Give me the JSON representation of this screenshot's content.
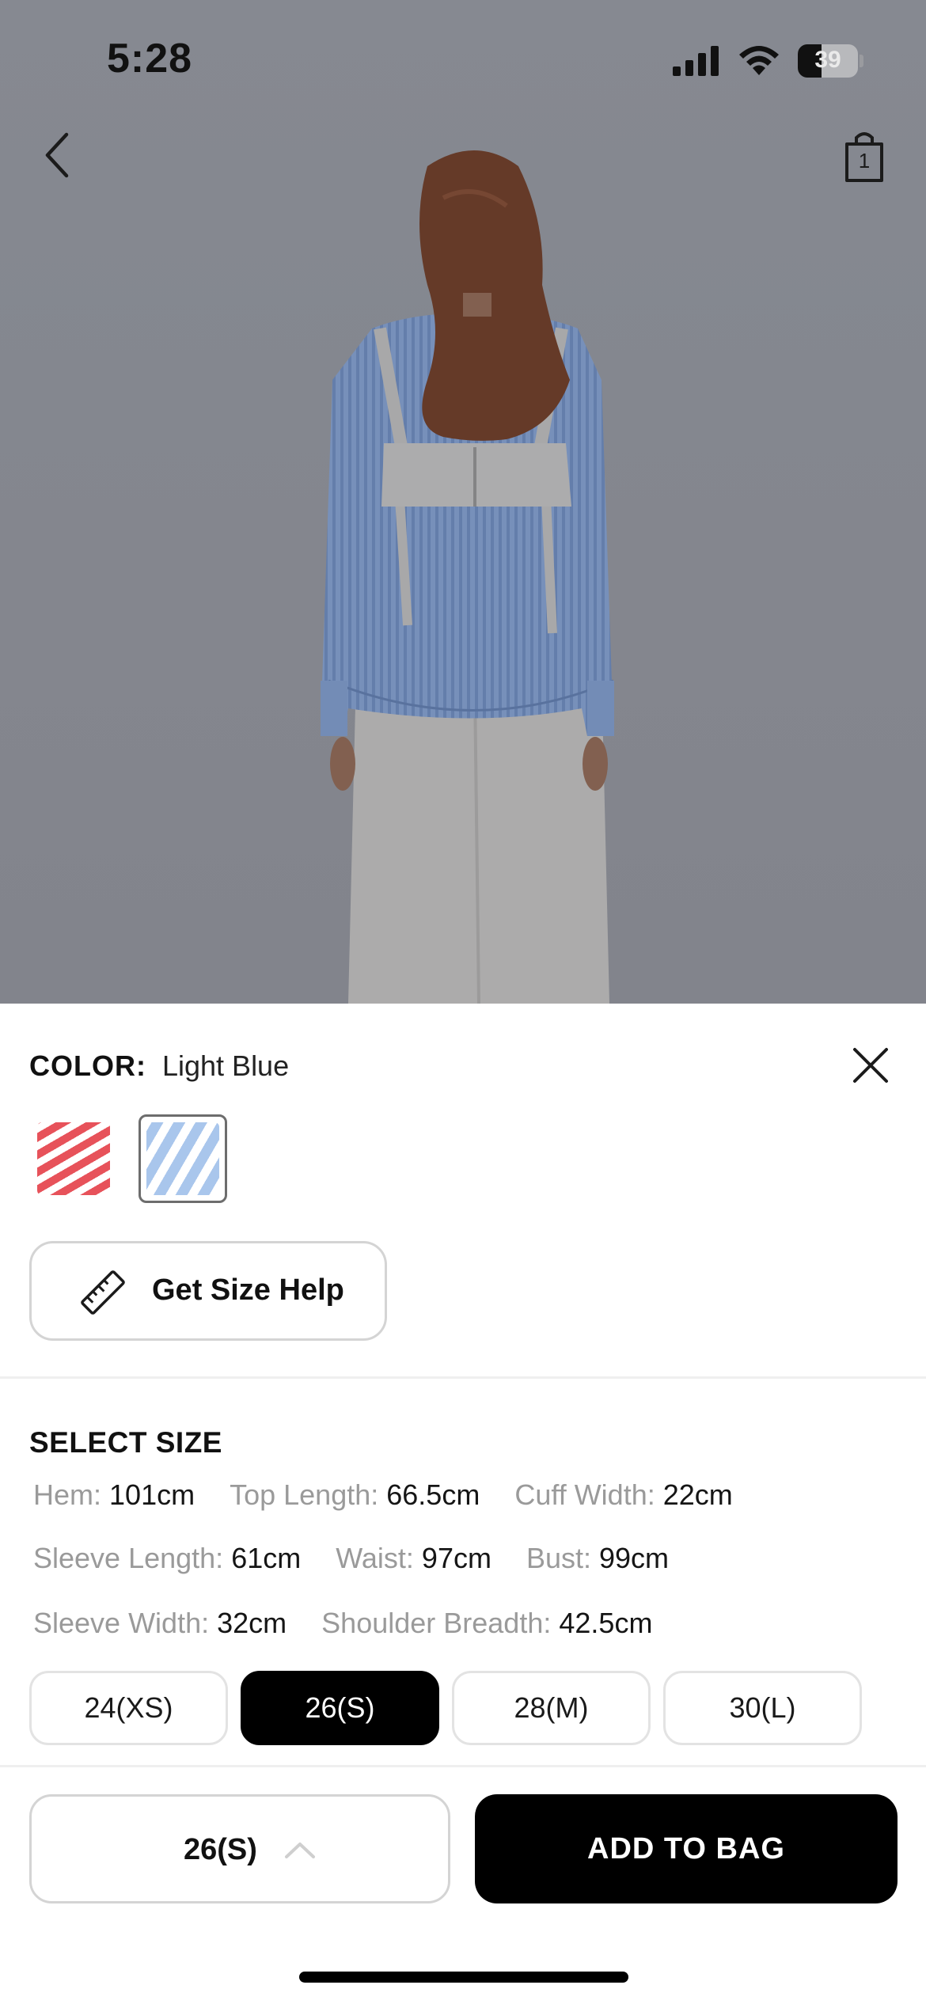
{
  "status_bar": {
    "time": "5:28",
    "battery_level": "39",
    "icons": [
      "cellular-signal-icon",
      "wifi-icon",
      "battery-icon"
    ]
  },
  "header": {
    "back_icon": "chevron-left-icon",
    "bag_icon": "shopping-bag-icon",
    "bag_count": "1"
  },
  "product_image": {
    "subject": "model-wearing-light-blue-striped-shirt-back-view"
  },
  "sheet": {
    "color_label": "COLOR:",
    "color_value": "Light Blue",
    "close_icon": "close-icon",
    "swatches": [
      {
        "id": "red-stripe",
        "color": "#e7525a",
        "selected": false
      },
      {
        "id": "light-blue-stripe",
        "color": "#a9c6ec",
        "selected": true
      }
    ],
    "size_help_label": "Get Size Help",
    "size_help_icon": "ruler-icon",
    "select_size_label": "SELECT SIZE",
    "measurements": [
      {
        "key": "Hem:",
        "value": "101cm"
      },
      {
        "key": "Top Length:",
        "value": "66.5cm"
      },
      {
        "key": "Cuff Width:",
        "value": "22cm"
      },
      {
        "key": "Sleeve Length:",
        "value": "61cm"
      },
      {
        "key": "Waist:",
        "value": "97cm"
      },
      {
        "key": "Bust:",
        "value": "99cm"
      },
      {
        "key": "Sleeve Width:",
        "value": "32cm"
      },
      {
        "key": "Shoulder Breadth:",
        "value": "42.5cm"
      }
    ],
    "sizes": [
      {
        "label": "24(XS)",
        "selected": false
      },
      {
        "label": "26(S)",
        "selected": true
      },
      {
        "label": "28(M)",
        "selected": false
      },
      {
        "label": "30(L)",
        "selected": false
      }
    ],
    "selected_size": "26(S)",
    "size_chevron_icon": "chevron-up-icon",
    "add_to_bag_label": "ADD TO BAG"
  },
  "colors": {
    "primary_button": "#000000",
    "muted_text": "#9a9a9a",
    "border": "#d4d4d4"
  }
}
